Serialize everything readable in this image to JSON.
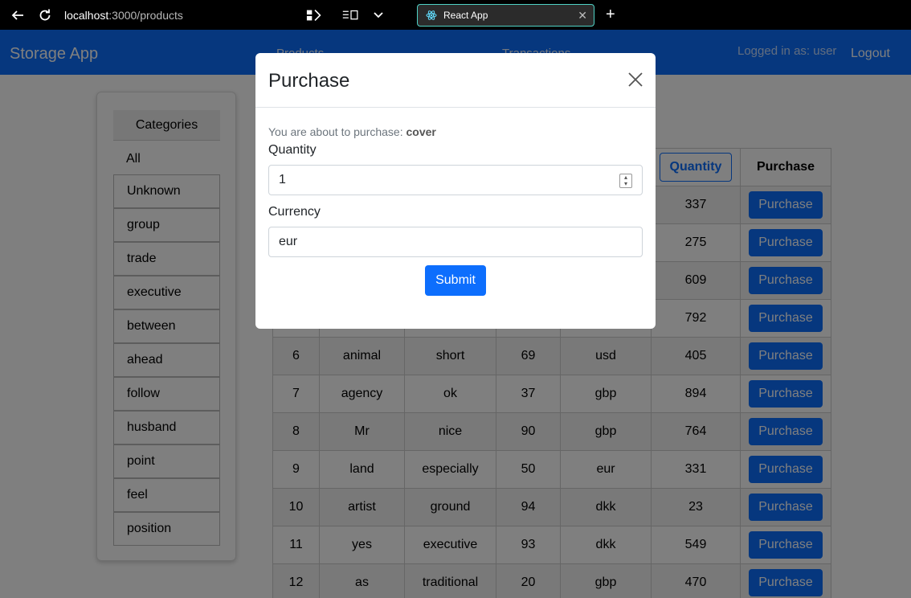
{
  "browser": {
    "url_host": "localhost",
    "url_path": ":3000/products",
    "tab_title": "React App"
  },
  "navbar": {
    "brand": "Storage App",
    "links": [
      "Products",
      "Transactions"
    ],
    "logged_in": "Logged in as: user",
    "logout": "Logout"
  },
  "sidebar": {
    "heading": "Categories",
    "items": [
      "All",
      "Unknown",
      "group",
      "trade",
      "executive",
      "between",
      "ahead",
      "follow",
      "husband",
      "point",
      "feel",
      "position"
    ]
  },
  "table": {
    "quantity_header": "Quantity",
    "purchase_header": "Purchase",
    "purchase_label": "Purchase",
    "rows": [
      [
        "",
        "",
        "",
        "",
        "",
        "337"
      ],
      [
        "",
        "",
        "",
        "",
        "",
        "275"
      ],
      [
        "",
        "",
        "",
        "",
        "",
        "609"
      ],
      [
        "",
        "",
        "",
        "",
        "",
        "792"
      ],
      [
        "6",
        "animal",
        "short",
        "69",
        "usd",
        "405"
      ],
      [
        "7",
        "agency",
        "ok",
        "37",
        "gbp",
        "894"
      ],
      [
        "8",
        "Mr",
        "nice",
        "90",
        "gbp",
        "764"
      ],
      [
        "9",
        "land",
        "especially",
        "50",
        "eur",
        "331"
      ],
      [
        "10",
        "artist",
        "ground",
        "94",
        "dkk",
        "23"
      ],
      [
        "11",
        "yes",
        "executive",
        "93",
        "dkk",
        "549"
      ],
      [
        "12",
        "as",
        "traditional",
        "20",
        "gbp",
        "470"
      ]
    ]
  },
  "modal": {
    "title": "Purchase",
    "about_prefix": "You are about to purchase: ",
    "product": "cover",
    "quantity_label": "Quantity",
    "quantity_value": "1",
    "currency_label": "Currency",
    "currency_value": "eur",
    "submit": "Submit"
  }
}
